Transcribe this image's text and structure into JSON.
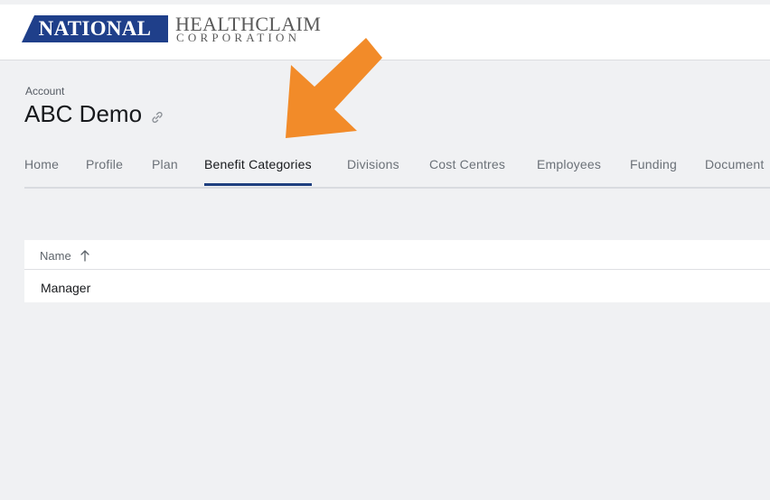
{
  "header": {
    "logo": {
      "national": "NATIONAL",
      "healthclaim": "HEALTHCLAIM",
      "corporation": "CORPORATION"
    }
  },
  "account": {
    "label": "Account",
    "title": "ABC Demo",
    "link_icon": "link-icon"
  },
  "tabs": [
    {
      "label": "Home",
      "active": false
    },
    {
      "label": "Profile",
      "active": false
    },
    {
      "label": "Plan",
      "active": false
    },
    {
      "label": "Benefit Categories",
      "active": true
    },
    {
      "label": "Divisions",
      "active": false
    },
    {
      "label": "Cost Centres",
      "active": false
    },
    {
      "label": "Employees",
      "active": false
    },
    {
      "label": "Funding",
      "active": false
    },
    {
      "label": "Document",
      "active": false
    }
  ],
  "table": {
    "columns": [
      {
        "label": "Name",
        "sort": "ascending",
        "sort_icon": "arrow-up-icon"
      }
    ],
    "rows": [
      {
        "name": "Manager"
      }
    ]
  },
  "annotation": {
    "type": "arrow",
    "color": "#f28b29",
    "icon": "pointer-arrow"
  },
  "colors": {
    "brand_navy": "#1f3f8a",
    "active_tab_underline": "#1f3f7f",
    "page_background": "#f0f1f3"
  }
}
